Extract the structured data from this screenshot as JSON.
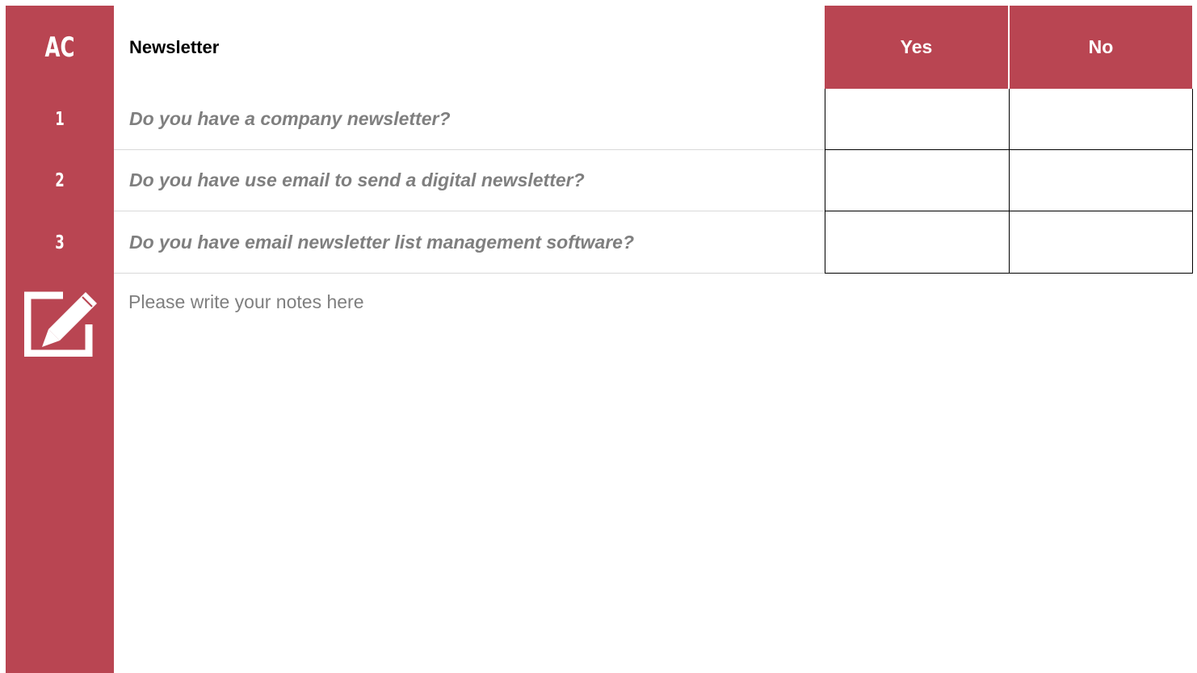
{
  "header": {
    "code": "AC",
    "title": "Newsletter",
    "yes_label": "Yes",
    "no_label": "No"
  },
  "rows": [
    {
      "number": "1",
      "question": "Do you have a company newsletter?"
    },
    {
      "number": "2",
      "question": "Do you have use email to send a digital newsletter?"
    },
    {
      "number": "3",
      "question": "Do you have email newsletter list management software?"
    }
  ],
  "notes": {
    "icon": "edit-notes-icon",
    "placeholder": "Please write your notes here"
  },
  "colors": {
    "accent": "#b94552",
    "question_text": "#7f7f7f",
    "border": "#000000"
  }
}
